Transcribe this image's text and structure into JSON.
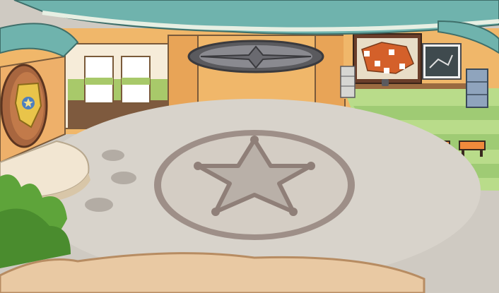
{
  "scene": {
    "location": "",
    "colors": {
      "roof_teal": "#6fb3ad",
      "roof_trim": "#e7efe3",
      "wall_orange": "#f0b76a",
      "pillar_orange": "#e8a457",
      "floor_gray": "#cfcac2",
      "floor_ring": "#9e8f88",
      "star_gray": "#b9b0a8",
      "grass_light": "#b9dc8a",
      "grass_dark": "#9fcb74",
      "badge_gold": "#e9c44a",
      "bench_orange": "#f08a3c",
      "path_tan": "#e9c9a3",
      "bush_green": "#5ea43a"
    },
    "objects": [
      {
        "name": "sheriff-star-emblem",
        "kind": "floor-decal"
      },
      {
        "name": "police-badge-sign",
        "kind": "wall-sign"
      },
      {
        "name": "pinned-map-board",
        "kind": "wall-board"
      },
      {
        "name": "tactics-whiteboard",
        "kind": "wall-board"
      },
      {
        "name": "filing-cabinet",
        "kind": "furniture",
        "count": 2
      },
      {
        "name": "training-bench",
        "kind": "furniture",
        "count": 3
      },
      {
        "name": "ceiling-vent-hatch",
        "kind": "fixture"
      }
    ]
  }
}
